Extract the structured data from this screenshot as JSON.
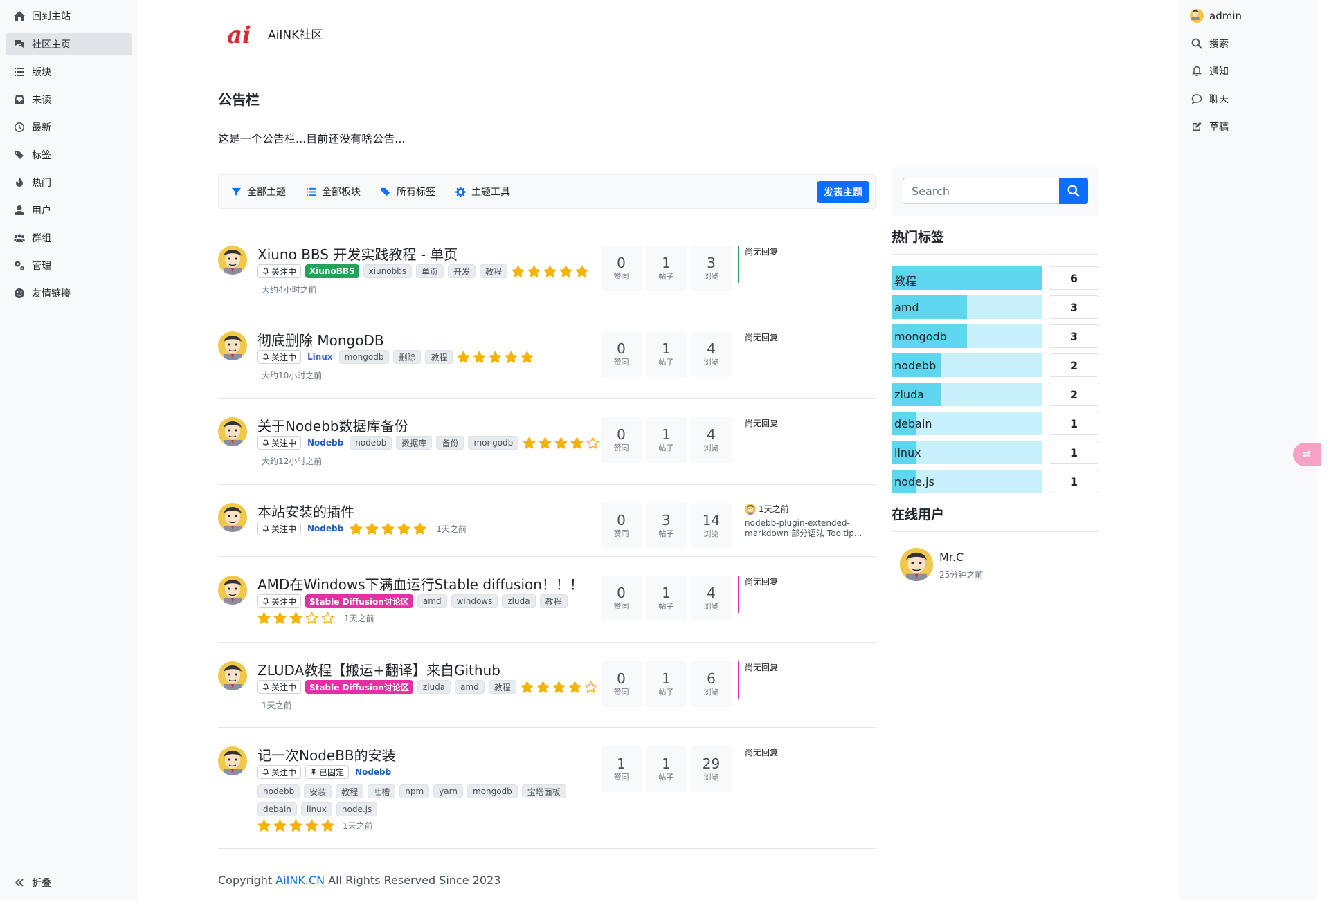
{
  "left_nav": [
    {
      "label": "回到主站",
      "icon": "home-icon"
    },
    {
      "label": "社区主页",
      "icon": "comments-icon",
      "active": true
    },
    {
      "label": "版块",
      "icon": "list-icon"
    },
    {
      "label": "未读",
      "icon": "inbox-icon"
    },
    {
      "label": "最新",
      "icon": "clock-icon"
    },
    {
      "label": "标签",
      "icon": "tags-icon"
    },
    {
      "label": "热门",
      "icon": "fire-icon"
    },
    {
      "label": "用户",
      "icon": "user-icon"
    },
    {
      "label": "群组",
      "icon": "users-icon"
    },
    {
      "label": "管理",
      "icon": "cogs-icon"
    },
    {
      "label": "友情链接",
      "icon": "smile-icon"
    }
  ],
  "collapse_label": "折叠",
  "right_nav": {
    "user": "admin",
    "items": [
      {
        "label": "搜索",
        "icon": "search-icon"
      },
      {
        "label": "通知",
        "icon": "bell-icon"
      },
      {
        "label": "聊天",
        "icon": "chat-icon"
      },
      {
        "label": "草稿",
        "icon": "edit-icon"
      }
    ]
  },
  "site": {
    "title": "AiINK社区"
  },
  "announcement": {
    "title": "公告栏",
    "text": "这是一个公告栏...目前还没有啥公告..."
  },
  "toolbar": {
    "items": [
      "全部主题",
      "全部板块",
      "所有标签",
      "主题工具"
    ],
    "post_button": "发表主题"
  },
  "topics": [
    {
      "title": "Xiuno BBS 开发实践教程 - 单页",
      "follow": "关注中",
      "category": "XiunoBBS",
      "tags": [
        "xiunobbs",
        "单页",
        "开发",
        "教程"
      ],
      "rating": 5,
      "time": "大约4小时之前",
      "votes": "0",
      "posts": "1",
      "views": "3",
      "reply": "尚无回复",
      "vote_label": "赞同",
      "post_label": "帖子",
      "view_label": "浏览"
    },
    {
      "title": "彻底删除 MongoDB",
      "follow": "关注中",
      "category": "Linux",
      "tags": [
        "mongodb",
        "删除",
        "教程"
      ],
      "rating": 5,
      "time": "大约10小时之前",
      "votes": "0",
      "posts": "1",
      "views": "4",
      "reply": "尚无回复",
      "vote_label": "赞同",
      "post_label": "帖子",
      "view_label": "浏览"
    },
    {
      "title": "关于Nodebb数据库备份",
      "follow": "关注中",
      "category": "Nodebb",
      "tags": [
        "nodebb",
        "数据库",
        "备份",
        "mongodb"
      ],
      "rating": 4,
      "time": "大约12小时之前",
      "votes": "0",
      "posts": "1",
      "views": "4",
      "reply": "尚无回复",
      "vote_label": "赞同",
      "post_label": "帖子",
      "view_label": "浏览"
    },
    {
      "title": "本站安装的插件",
      "follow": "关注中",
      "category": "Nodebb",
      "tags": [],
      "rating": 5,
      "time": "1天之前",
      "votes": "0",
      "posts": "3",
      "views": "14",
      "reply_time": "1天之前",
      "reply_text": "nodebb-plugin-extended-markdown 部分语法 Tooltip...",
      "vote_label": "赞同",
      "post_label": "帖子",
      "view_label": "浏览"
    },
    {
      "title": "AMD在Windows下满血运行Stable diffusion！！！",
      "follow": "关注中",
      "category": "Stable Diffusion讨论区",
      "tags": [
        "amd",
        "windows",
        "zluda",
        "教程"
      ],
      "rating": 3,
      "time": "1天之前",
      "votes": "0",
      "posts": "1",
      "views": "4",
      "reply": "尚无回复",
      "vote_label": "赞同",
      "post_label": "帖子",
      "view_label": "浏览"
    },
    {
      "title": "ZLUDA教程【搬运+翻译】来自Github",
      "follow": "关注中",
      "category": "Stable Diffusion讨论区",
      "tags": [
        "zluda",
        "amd",
        "教程"
      ],
      "rating": 4,
      "time": "1天之前",
      "votes": "0",
      "posts": "1",
      "views": "6",
      "reply": "尚无回复",
      "vote_label": "赞同",
      "post_label": "帖子",
      "view_label": "浏览"
    },
    {
      "title": "记一次NodeBB的安装",
      "follow": "关注中",
      "pinned": "已固定",
      "category": "Nodebb",
      "tags": [
        "nodebb",
        "安装",
        "教程",
        "吐槽",
        "npm",
        "yarn",
        "mongodb",
        "宝塔面板",
        "debain",
        "linux",
        "node.js"
      ],
      "rating": 5,
      "time": "1天之前",
      "votes": "1",
      "posts": "1",
      "views": "29",
      "reply": "尚无回复",
      "vote_label": "赞同",
      "post_label": "帖子",
      "view_label": "浏览"
    }
  ],
  "search": {
    "placeholder": "Search"
  },
  "hot_tags": {
    "title": "热门标签",
    "items": [
      {
        "name": "教程",
        "count": "6",
        "ratio": 1.0
      },
      {
        "name": "amd",
        "count": "3",
        "ratio": 0.5
      },
      {
        "name": "mongodb",
        "count": "3",
        "ratio": 0.5
      },
      {
        "name": "nodebb",
        "count": "2",
        "ratio": 0.333
      },
      {
        "name": "zluda",
        "count": "2",
        "ratio": 0.333
      },
      {
        "name": "debain",
        "count": "1",
        "ratio": 0.167
      },
      {
        "name": "linux",
        "count": "1",
        "ratio": 0.167
      },
      {
        "name": "node.js",
        "count": "1",
        "ratio": 0.167
      }
    ]
  },
  "online": {
    "title": "在线用户",
    "name": "Mr.C",
    "time": "25分钟之前"
  },
  "footer": {
    "prefix": "Copyright ",
    "link": "AiINK.CN",
    "suffix": " All Rights Reserved Since 2023"
  }
}
